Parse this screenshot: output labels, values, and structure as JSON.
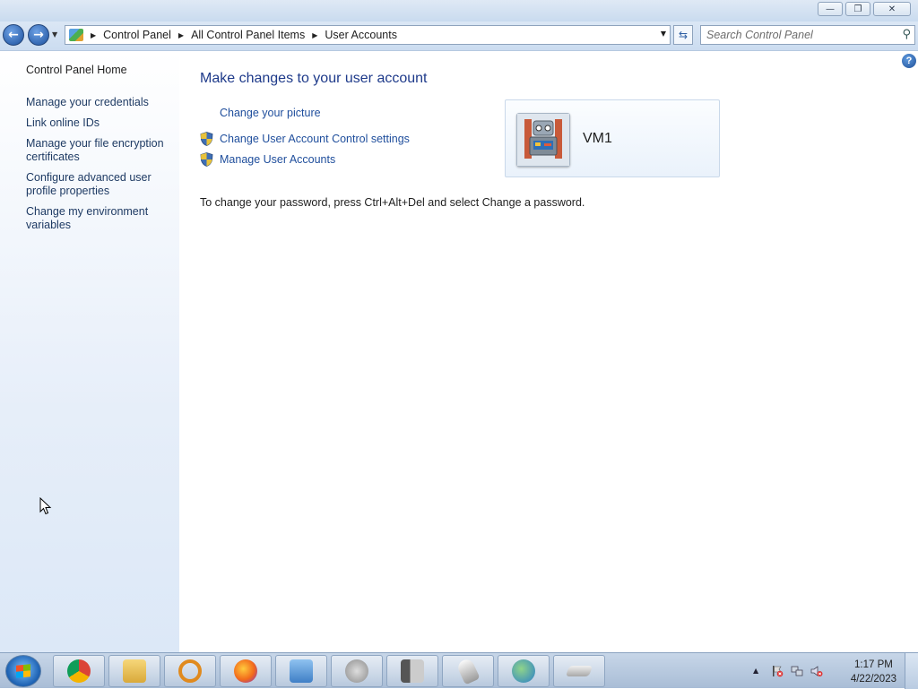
{
  "window": {
    "minimize_glyph": "—",
    "restore_glyph": "❐",
    "close_glyph": "✕"
  },
  "nav": {
    "back_glyph": "←",
    "forward_glyph": "→",
    "history_glyph": "▼",
    "breadcrumbs": [
      "Control Panel",
      "All Control Panel Items",
      "User Accounts"
    ],
    "crumb_separator": "▶",
    "address_dropdown_glyph": "▼",
    "refresh_glyph": "⇆",
    "search_placeholder": "Search Control Panel",
    "search_glyph": "⚲"
  },
  "sidebar": {
    "home": "Control Panel Home",
    "items": [
      {
        "label": "Manage your credentials"
      },
      {
        "label": "Link online IDs"
      },
      {
        "label": "Manage your file encryption certificates"
      },
      {
        "label": "Configure advanced user profile properties"
      },
      {
        "label": "Change my environment variables"
      }
    ]
  },
  "main": {
    "help_glyph": "?",
    "heading": "Make changes to your user account",
    "tasks": [
      {
        "label": "Change your picture",
        "shield": false
      },
      {
        "label": "Change User Account Control settings",
        "shield": true
      },
      {
        "label": "Manage User Accounts",
        "shield": true
      }
    ],
    "note": "To change your password, press Ctrl+Alt+Del and select Change a password.",
    "account": {
      "name": "VM1",
      "picture_icon": "robot-avatar-icon"
    }
  },
  "taskbar": {
    "pinned": [
      {
        "name": "chrome-icon"
      },
      {
        "name": "file-explorer-icon"
      },
      {
        "name": "magnifier-search-icon"
      },
      {
        "name": "firefox-icon"
      },
      {
        "name": "control-panel-icon"
      },
      {
        "name": "speaker-icon"
      },
      {
        "name": "computer-icon"
      },
      {
        "name": "mouse-icon"
      },
      {
        "name": "globe-checklist-icon"
      },
      {
        "name": "keyboard-icon"
      }
    ],
    "tray": {
      "show_hidden_glyph": "▲",
      "time": "1:17 PM",
      "date": "4/22/2023"
    }
  },
  "colors": {
    "link": "#1f4e9c",
    "heading": "#1e3a8a",
    "sidebar_link": "#1e3a63"
  }
}
